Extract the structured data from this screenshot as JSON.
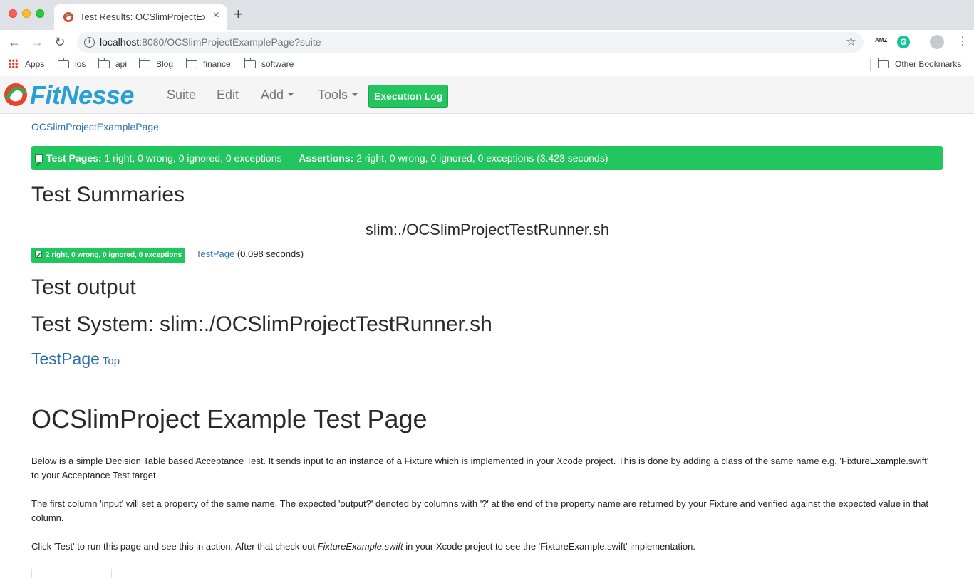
{
  "browser": {
    "tab_title": "Test Results: OCSlimProjectExa",
    "tab_close": "×",
    "new_tab": "+",
    "url_host": "localhost",
    "url_rest": ":8080/OCSlimProjectExamplePage?suite",
    "info_icon": "i",
    "star": "☆",
    "ext_amz": "AMZ",
    "ext_g": "G",
    "menu": "⋮",
    "bookmarks": [
      "Apps",
      "ios",
      "api",
      "Blog",
      "finance",
      "software"
    ],
    "other_bookmarks": "Other Bookmarks"
  },
  "fitnesse": {
    "logo_text": "FitNesse",
    "menu": [
      "Suite",
      "Edit",
      "Add",
      "Tools"
    ],
    "execution_log": "Execution Log"
  },
  "content": {
    "breadcrumb": "OCSlimProjectExamplePage",
    "banner": {
      "test_pages_label": "Test Pages:",
      "test_pages_value": "1 right, 0 wrong, 0 ignored, 0 exceptions",
      "assertions_label": "Assertions:",
      "assertions_value": "2 right, 0 wrong, 0 ignored, 0 exceptions (3.423 seconds)"
    },
    "test_summaries_heading": "Test Summaries",
    "runner_title": "slim:./OCSlimProjectTestRunner.sh",
    "summary_badge": "2 right, 0 wrong, 0 ignored, 0 exceptions",
    "summary_link": "TestPage",
    "summary_time": "(0.098 seconds)",
    "test_output_heading": "Test output",
    "test_system_heading": "Test System: slim:./OCSlimProjectTestRunner.sh",
    "testpage_link": "TestPage",
    "top_link": "Top",
    "page_heading": "OCSlimProject Example Test Page",
    "para1": "Below is a simple Decision Table based Acceptance Test. It sends input to an instance of a Fixture which is implemented in your Xcode project. This is done by adding a class of the same name e.g. 'FixtureExample.swift' to your Acceptance Test target.",
    "para2": "The first column 'input' will set a property of the same name. The expected 'output?' denoted by columns with '?' at the end of the property name are returned by your Fixture and verified against the expected value in that column.",
    "para3_a": "Click 'Test' to run this page and see this in action. After that check out ",
    "para3_em": "FixtureExample.swift",
    "para3_b": " in your Xcode project to see the 'FixtureExample.swift' implementation."
  },
  "colors": {
    "pass_green": "#22c55e",
    "link_blue": "#2a6fb0",
    "logo_blue": "#2a9fd6"
  }
}
